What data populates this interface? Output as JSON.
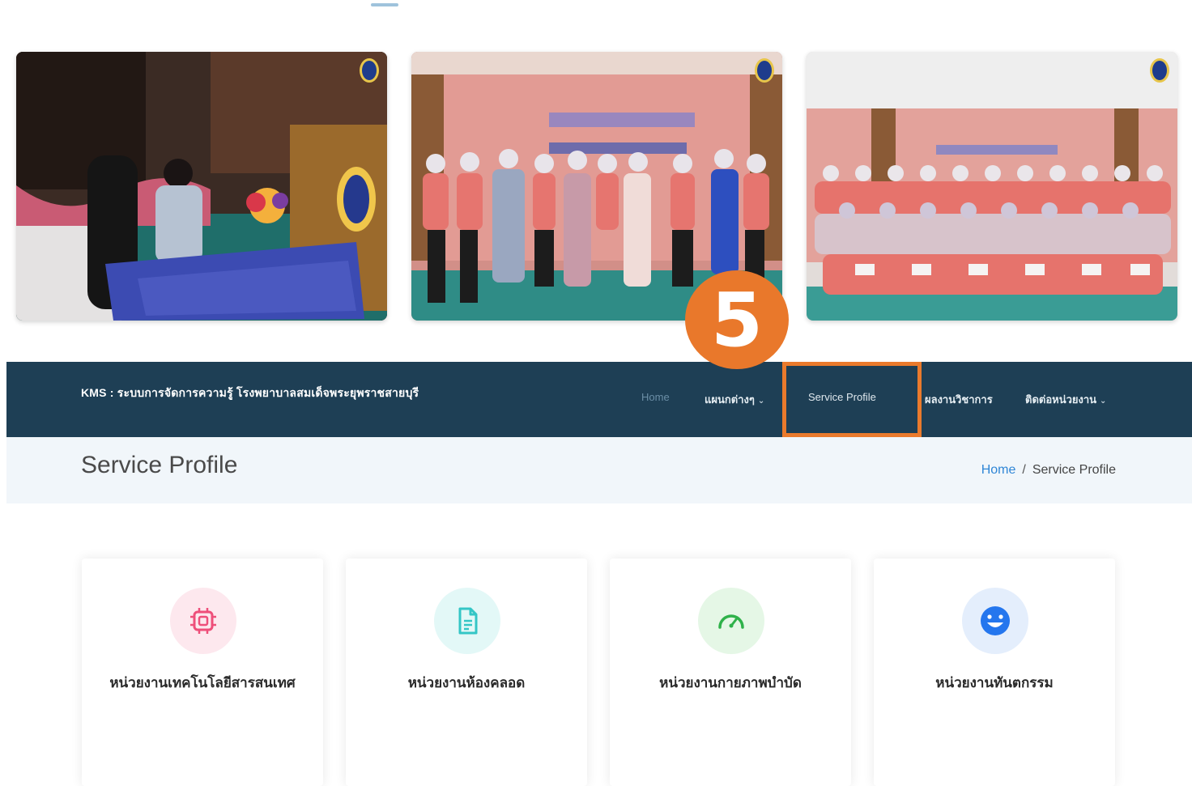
{
  "step_badge": "5",
  "navbar": {
    "brand": "KMS : ระบบการจัดการความรู้ โรงพยาบาลสมเด็จพระยุพราชสายบุรี",
    "items": [
      {
        "label": "Home"
      },
      {
        "label": "แผนกต่างๆ"
      },
      {
        "label": "Service Profile"
      },
      {
        "label": "ผลงานวิชาการ"
      },
      {
        "label": "ติดต่อหน่วยงาน"
      }
    ]
  },
  "page_header": {
    "title": "Service Profile",
    "breadcrumb": {
      "home": "Home",
      "separator": "/",
      "current": "Service Profile"
    }
  },
  "cards": [
    {
      "label": "หน่วยงานเทคโนโลยีสารสนเทศ",
      "icon": "chip-icon",
      "icon_color": "#ee4f7a",
      "icon_bg": "#fde8ee"
    },
    {
      "label": "หน่วยงานห้องคลอด",
      "icon": "document-icon",
      "icon_color": "#34c6c6",
      "icon_bg": "#e3f8f7"
    },
    {
      "label": "หน่วยงานกายภาพบำบัด",
      "icon": "speedometer-icon",
      "icon_color": "#2fb24a",
      "icon_bg": "#e5f7e6"
    },
    {
      "label": "หน่วยงานทันตกรรม",
      "icon": "smile-icon",
      "icon_color": "#2476ee",
      "icon_bg": "#e4eefc"
    }
  ],
  "colors": {
    "navbar_bg": "#1e3f55",
    "highlight": "#ea7a2c",
    "header_bg": "#f1f6fa",
    "link": "#2f86d6"
  }
}
